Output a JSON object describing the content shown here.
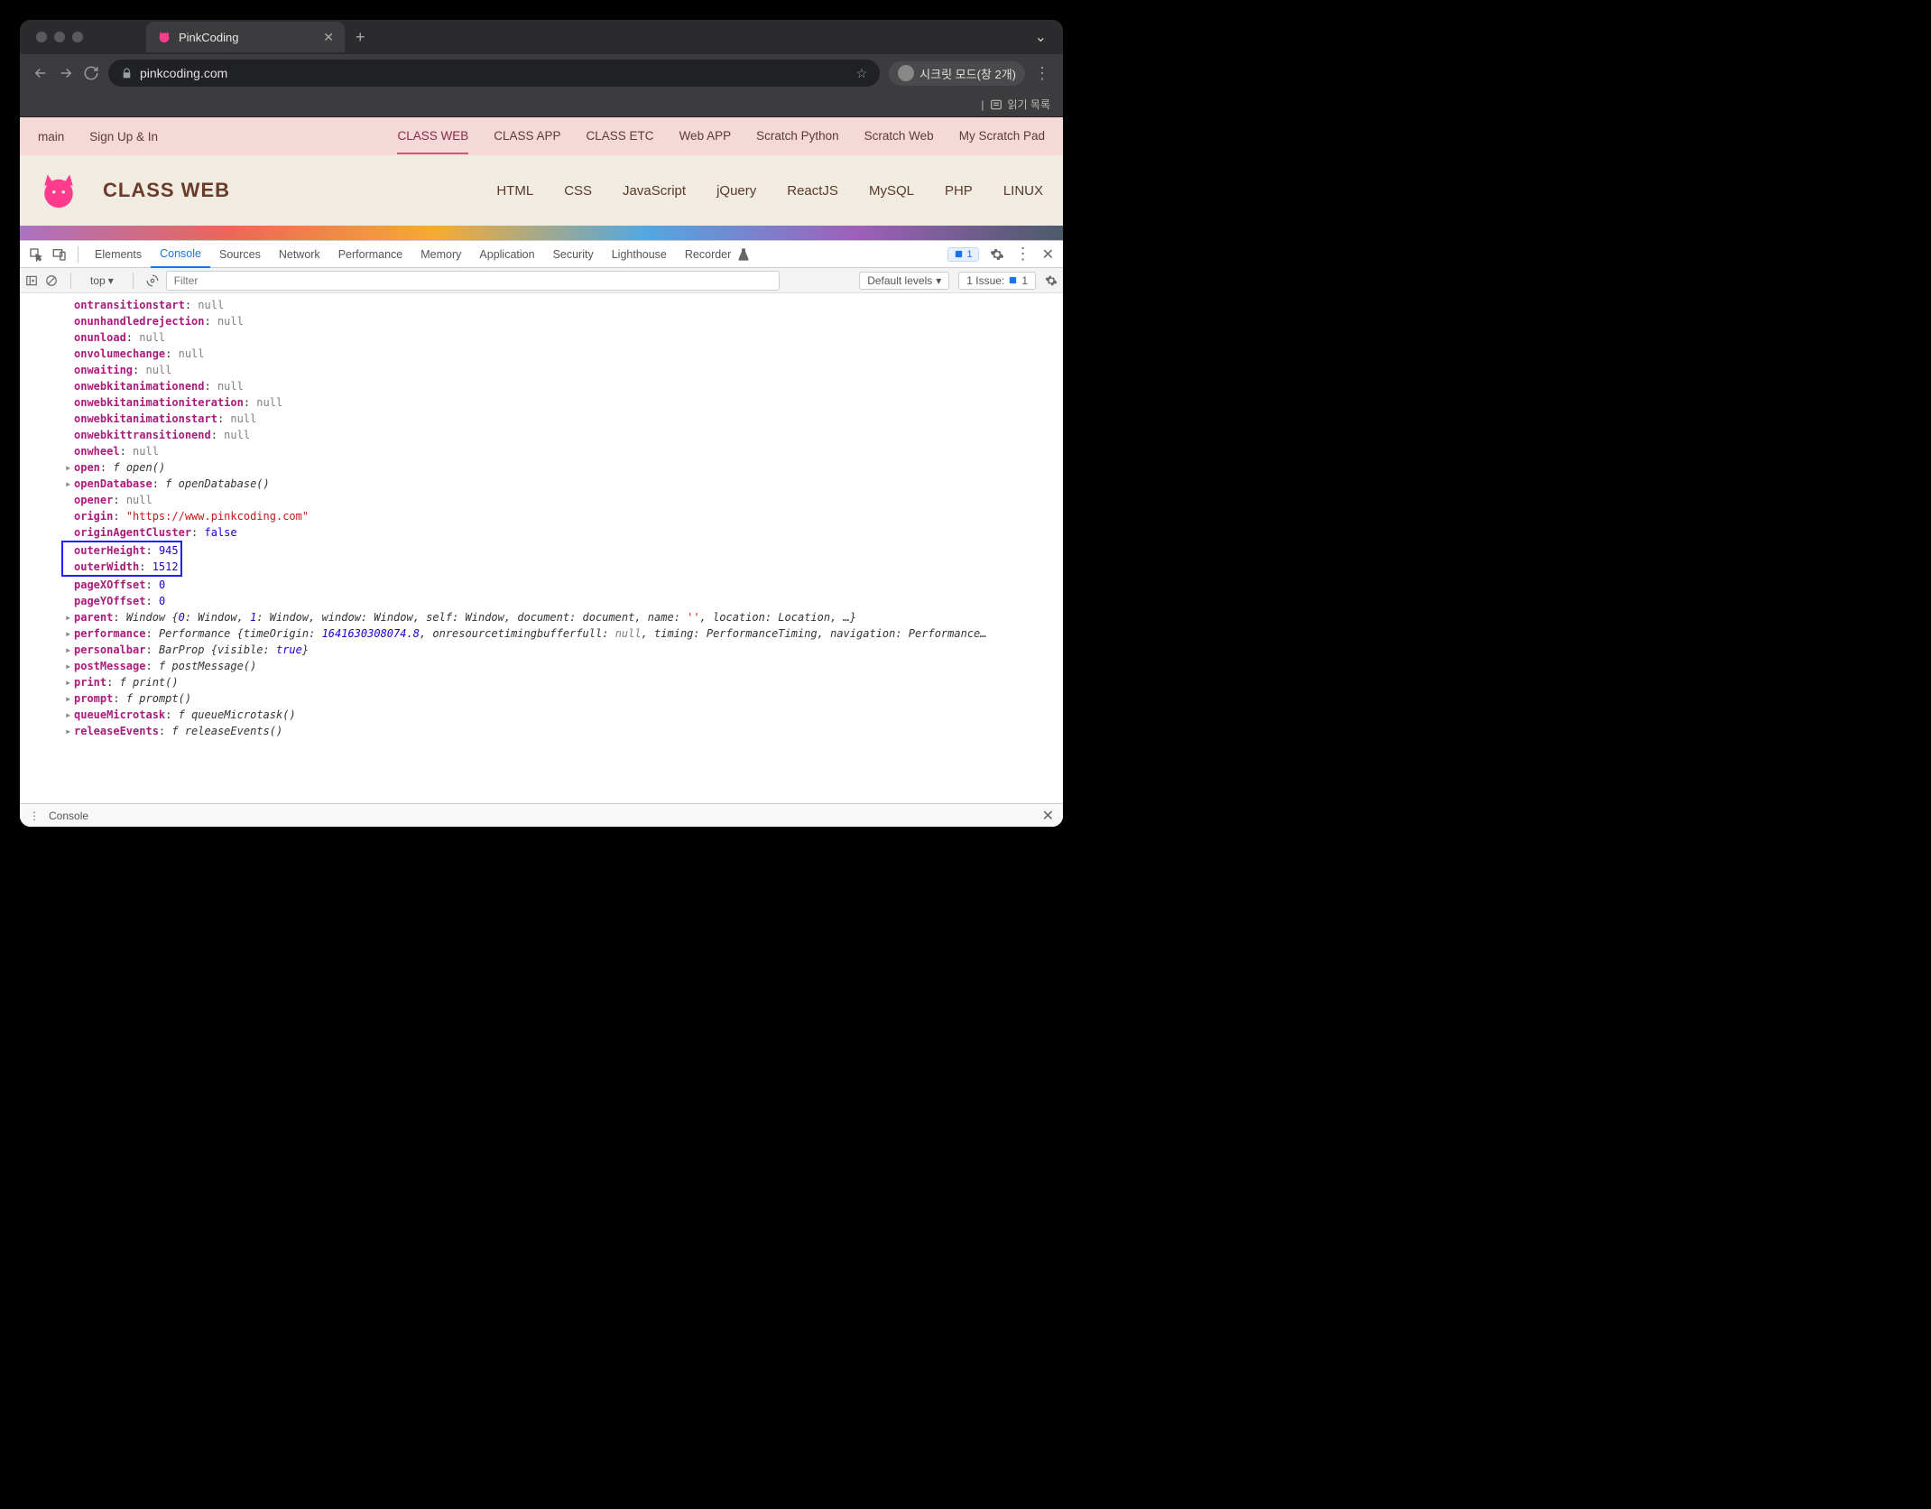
{
  "browser": {
    "tab_title": "PinkCoding",
    "url_display": "pinkcoding.com",
    "incognito_label": "시크릿 모드(창 2개)",
    "reading_list": "읽기 목록"
  },
  "topnav": {
    "left": [
      "main",
      "Sign Up & In"
    ],
    "right": [
      "CLASS WEB",
      "CLASS APP",
      "CLASS ETC",
      "Web APP",
      "Scratch Python",
      "Scratch Web",
      "My Scratch Pad"
    ],
    "active_index": 0
  },
  "subheader": {
    "title": "CLASS WEB",
    "items": [
      "HTML",
      "CSS",
      "JavaScript",
      "jQuery",
      "ReactJS",
      "MySQL",
      "PHP",
      "LINUX"
    ]
  },
  "devtools": {
    "tabs": [
      "Elements",
      "Console",
      "Sources",
      "Network",
      "Performance",
      "Memory",
      "Application",
      "Security",
      "Lighthouse",
      "Recorder"
    ],
    "active_tab": "Console",
    "badge_count": "1",
    "console_toolbar": {
      "context": "top",
      "filter_placeholder": "Filter",
      "levels": "Default levels",
      "issue_label": "1 Issue:",
      "issue_count": "1"
    },
    "drawer_label": "Console"
  },
  "console_lines": [
    {
      "key": "ontransitionstart",
      "val": "null",
      "type": "null"
    },
    {
      "key": "onunhandledrejection",
      "val": "null",
      "type": "null"
    },
    {
      "key": "onunload",
      "val": "null",
      "type": "null"
    },
    {
      "key": "onvolumechange",
      "val": "null",
      "type": "null"
    },
    {
      "key": "onwaiting",
      "val": "null",
      "type": "null"
    },
    {
      "key": "onwebkitanimationend",
      "val": "null",
      "type": "null"
    },
    {
      "key": "onwebkitanimationiteration",
      "val": "null",
      "type": "null"
    },
    {
      "key": "onwebkitanimationstart",
      "val": "null",
      "type": "null"
    },
    {
      "key": "onwebkittransitionend",
      "val": "null",
      "type": "null"
    },
    {
      "key": "onwheel",
      "val": "null",
      "type": "null"
    },
    {
      "key": "open",
      "val": "f open()",
      "type": "func",
      "expand": true
    },
    {
      "key": "openDatabase",
      "val": "f openDatabase()",
      "type": "func",
      "expand": true
    },
    {
      "key": "opener",
      "val": "null",
      "type": "null"
    },
    {
      "key": "origin",
      "val": "\"https://www.pinkcoding.com\"",
      "type": "string"
    },
    {
      "key": "originAgentCluster",
      "val": "false",
      "type": "bool"
    },
    {
      "key": "outerHeight",
      "val": "945",
      "type": "num",
      "highlight": true
    },
    {
      "key": "outerWidth",
      "val": "1512",
      "type": "num",
      "highlight": true
    },
    {
      "key": "pageXOffset",
      "val": "0",
      "type": "num"
    },
    {
      "key": "pageYOffset",
      "val": "0",
      "type": "num"
    },
    {
      "key": "parent",
      "val_raw": "Window {0: Window, 1: Window, window: Window, self: Window, document: document, name: '', location: Location, …}",
      "type": "obj",
      "expand": true
    },
    {
      "key": "performance",
      "val_raw": "Performance {timeOrigin: 1641630308074.8, onresourcetimingbufferfull: null, timing: PerformanceTiming, navigation: Performance…",
      "type": "obj",
      "expand": true
    },
    {
      "key": "personalbar",
      "val_raw": "BarProp {visible: true}",
      "type": "obj",
      "expand": true
    },
    {
      "key": "postMessage",
      "val": "f postMessage()",
      "type": "func",
      "expand": true
    },
    {
      "key": "print",
      "val": "f print()",
      "type": "func",
      "expand": true
    },
    {
      "key": "prompt",
      "val": "f prompt()",
      "type": "func",
      "expand": true
    },
    {
      "key": "queueMicrotask",
      "val": "f queueMicrotask()",
      "type": "func",
      "expand": true
    },
    {
      "key": "releaseEvents",
      "val": "f releaseEvents()",
      "type": "func",
      "expand": true
    }
  ]
}
